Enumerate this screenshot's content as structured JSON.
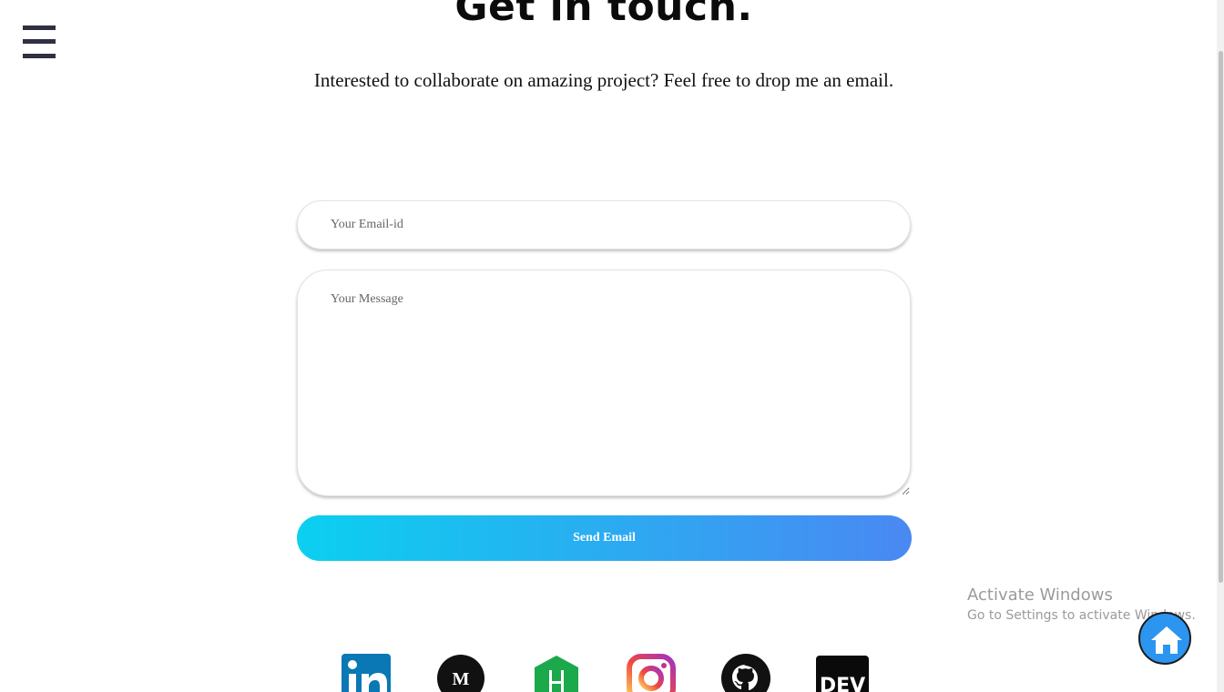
{
  "nav": {
    "menu_icon": "hamburger-menu-icon"
  },
  "header": {
    "title": "Get in touch.",
    "subtitle": "Interested to collaborate on amazing project? Feel free to drop me an email."
  },
  "form": {
    "email_placeholder": "Your Email-id",
    "email_value": "",
    "message_placeholder": "Your Message",
    "message_value": "",
    "send_label": "Send Email"
  },
  "colors": {
    "button_gradient_start": "#0bd0f0",
    "button_gradient_end": "#4a88f2",
    "menu_icon": "#2f3142",
    "home_button": "#2b95f0"
  },
  "social_links": [
    {
      "name": "LinkedIn",
      "icon": "linkedin-icon",
      "glyph": "in"
    },
    {
      "name": "Medium",
      "icon": "medium-icon",
      "glyph": "M"
    },
    {
      "name": "HackerRank",
      "icon": "hackerrank-icon",
      "glyph": "H"
    },
    {
      "name": "Instagram",
      "icon": "instagram-icon",
      "glyph": ""
    },
    {
      "name": "GitHub",
      "icon": "github-icon",
      "glyph": ""
    },
    {
      "name": "DEV",
      "icon": "dev-icon",
      "glyph": "DEV"
    }
  ],
  "watermark": {
    "title": "Activate Windows",
    "subtitle": "Go to Settings to activate Windows."
  },
  "home_button": {
    "icon": "home-icon"
  }
}
